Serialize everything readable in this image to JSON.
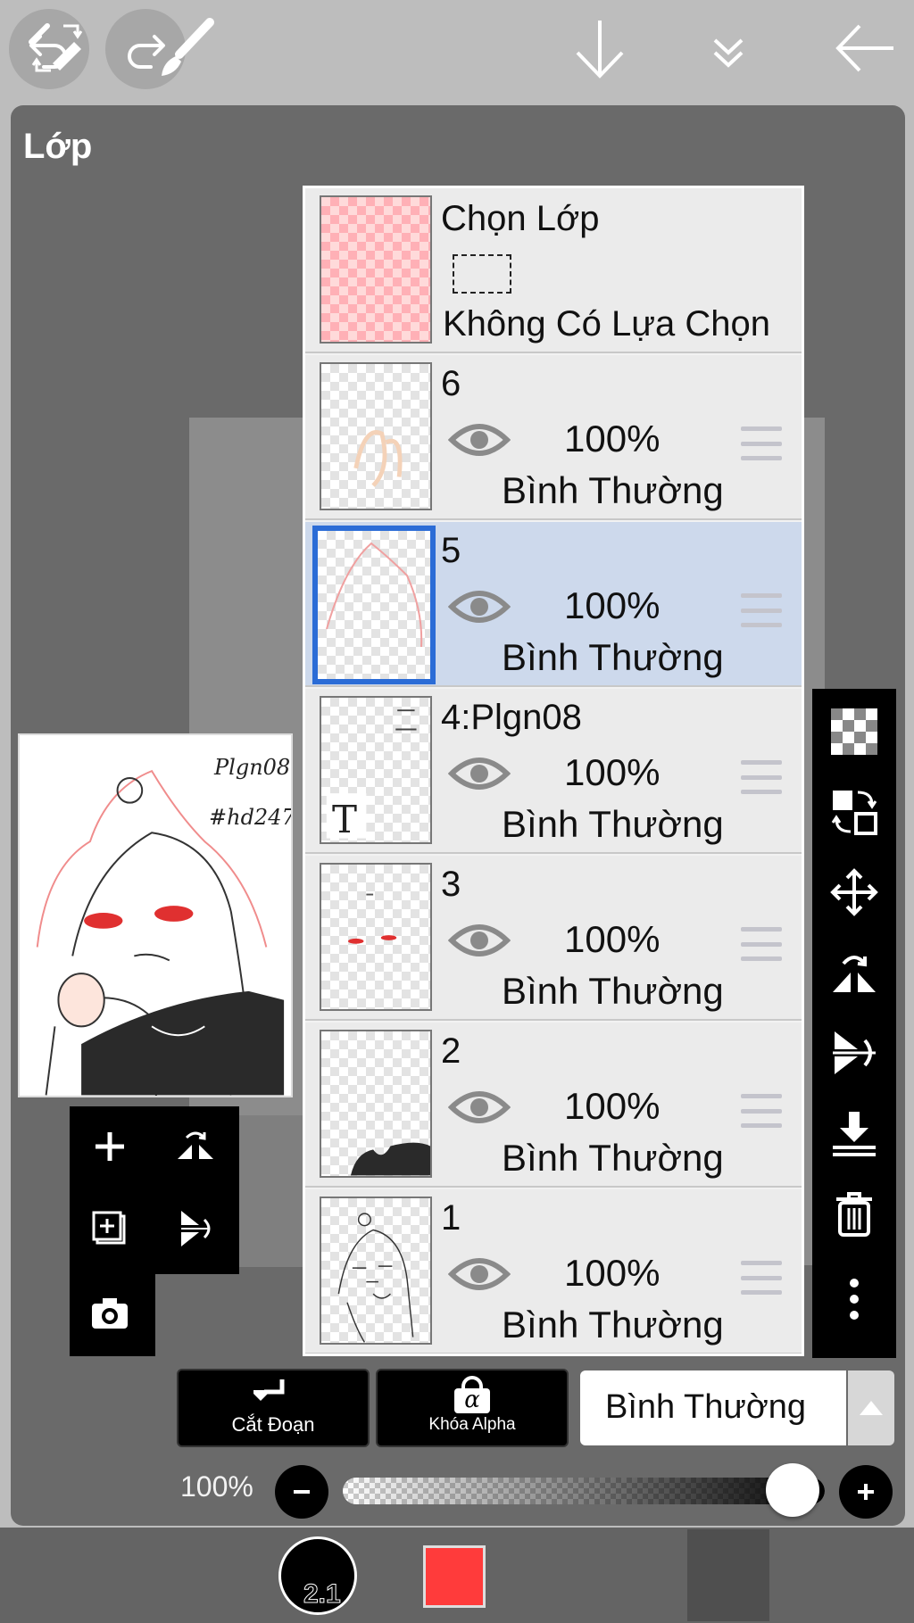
{
  "header": {
    "undo_icon": "undo-icon",
    "redo_icon": "redo-icon"
  },
  "panel": {
    "title": "Lớp"
  },
  "preview": {
    "signature_line1": "Plgn08",
    "signature_line2": "#hd247"
  },
  "layers": {
    "selection": {
      "title": "Chọn Lớp",
      "status": "Không Có Lựa Chọn"
    },
    "items": [
      {
        "name": "6",
        "opacity": "100%",
        "blend": "Bình Thường",
        "selected": false
      },
      {
        "name": "5",
        "opacity": "100%",
        "blend": "Bình Thường",
        "selected": true
      },
      {
        "name": "4:Plgn08",
        "opacity": "100%",
        "blend": "Bình Thường",
        "selected": false,
        "text_layer_glyph": "T"
      },
      {
        "name": "3",
        "opacity": "100%",
        "blend": "Bình Thường",
        "selected": false
      },
      {
        "name": "2",
        "opacity": "100%",
        "blend": "Bình Thường",
        "selected": false
      },
      {
        "name": "1",
        "opacity": "100%",
        "blend": "Bình Thường",
        "selected": false
      }
    ]
  },
  "actions": {
    "clipping_label": "Cắt Đoạn",
    "alpha_lock_label": "Khóa Alpha",
    "alpha_glyph": "α",
    "blend_mode": "Bình Thường"
  },
  "opacity": {
    "label": "100%",
    "value": 1.0
  },
  "bottom_bar": {
    "brush_size": "2.1",
    "color": "#ff3b3b"
  },
  "colors": {
    "selected_layer": "#cdd9ec",
    "active_thumb_border": "#2b6cd6"
  }
}
